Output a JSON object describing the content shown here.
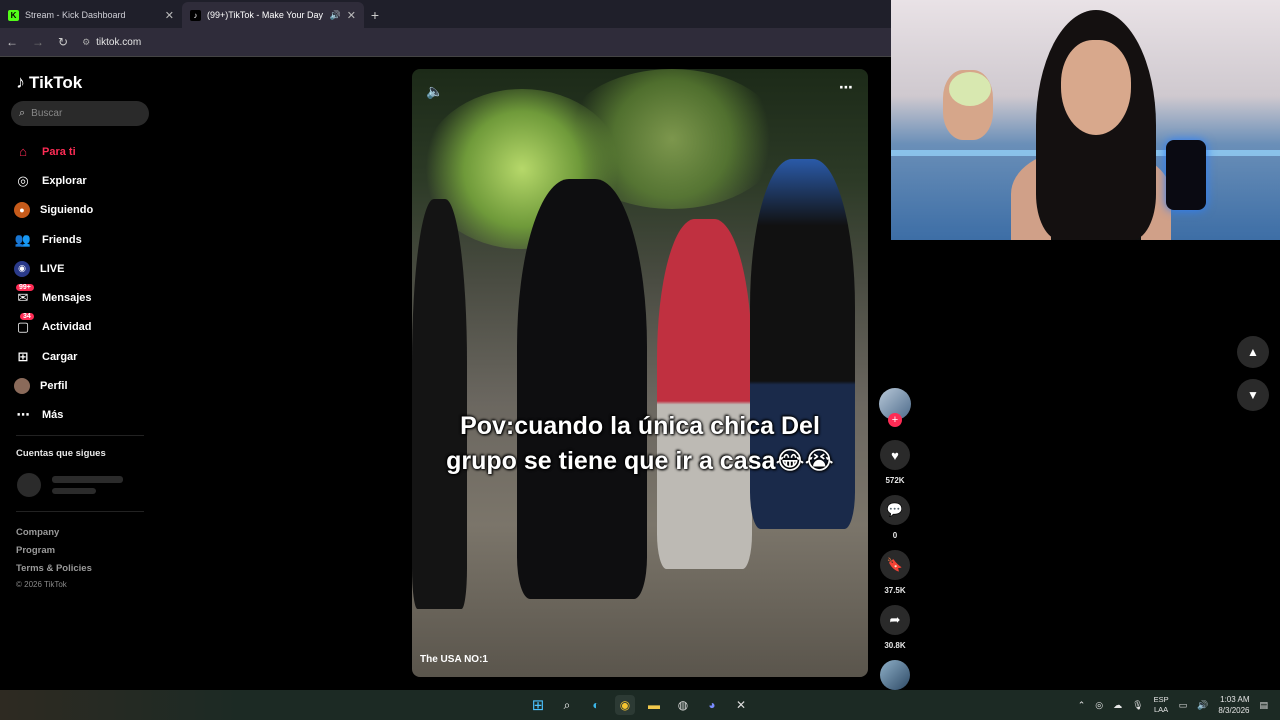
{
  "browser": {
    "tabs": [
      {
        "title": "Stream - Kick Dashboard",
        "favicon": "K",
        "active": false
      },
      {
        "title": "(99+)TikTok - Make Your Day",
        "favicon": "♪",
        "active": true
      }
    ],
    "url": "tiktok.com"
  },
  "sidebar": {
    "logo_text": "TikTok",
    "search_placeholder": "Buscar",
    "nav": [
      {
        "label": "Para ti",
        "icon": "home-icon",
        "active": true
      },
      {
        "label": "Explorar",
        "icon": "compass-icon"
      },
      {
        "label": "Siguiendo",
        "icon": "following-icon"
      },
      {
        "label": "Friends",
        "icon": "friends-icon"
      },
      {
        "label": "LIVE",
        "icon": "live-icon"
      },
      {
        "label": "Mensajes",
        "icon": "messages-icon",
        "badge": "99+"
      },
      {
        "label": "Actividad",
        "icon": "activity-icon",
        "badge": "34"
      },
      {
        "label": "Cargar",
        "icon": "upload-icon"
      },
      {
        "label": "Perfil",
        "icon": "profile-icon"
      },
      {
        "label": "Más",
        "icon": "more-icon"
      }
    ],
    "following_title": "Cuentas que sigues",
    "footer": {
      "links": [
        "Company",
        "Program",
        "Terms & Policies"
      ],
      "copyright": "© 2026 TikTok"
    }
  },
  "video": {
    "caption": "Pov:cuando la única chica Del grupo se tiene que ir a casa😂😭",
    "author_overlay": "The USA NO:1"
  },
  "actions": {
    "likes": "572K",
    "comments": "0",
    "saves": "37.5K",
    "shares": "30.8K"
  },
  "taskbar": {
    "language": [
      "ESP",
      "LAA"
    ],
    "time": "1:03 AM",
    "date": "8/3/2026"
  },
  "colors": {
    "accent": "#fe2c55",
    "background": "#000000"
  }
}
